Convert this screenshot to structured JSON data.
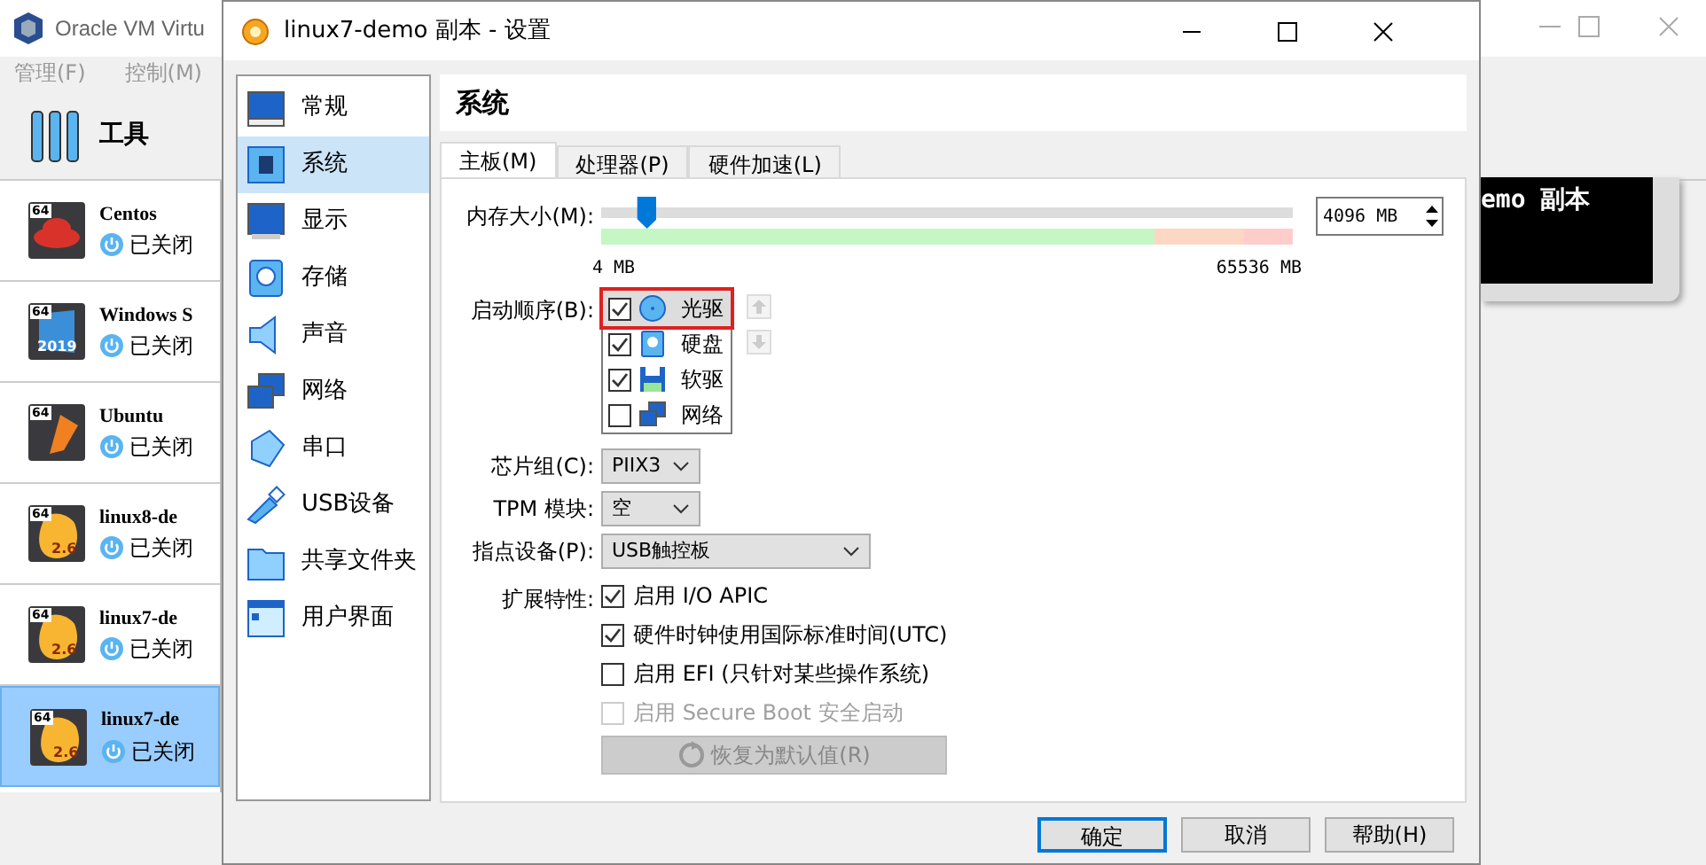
{
  "main_window": {
    "title": "Oracle VM Virtu",
    "menu": [
      "管理(F)",
      "控制(M)"
    ],
    "tools_label": "工具",
    "vms": [
      {
        "name": "Centos",
        "state": "已关闭",
        "badge": "64",
        "selected": false
      },
      {
        "name": "Windows S",
        "state": "已关闭",
        "badge": "64",
        "version": "2019",
        "selected": false
      },
      {
        "name": "Ubuntu",
        "state": "已关闭",
        "badge": "64",
        "selected": false
      },
      {
        "name": "linux8-de",
        "state": "已关闭",
        "badge": "64",
        "version": "2.6",
        "selected": false
      },
      {
        "name": "linux7-de",
        "state": "已关闭",
        "badge": "64",
        "version": "2.6",
        "selected": false
      },
      {
        "name": "linux7-de",
        "state": "已关闭",
        "badge": "64",
        "version": "2.6",
        "selected": true
      }
    ],
    "preview_text": "emo 副本"
  },
  "dialog": {
    "title": "linux7-demo 副本 - 设置",
    "nav": [
      {
        "label": "常规",
        "selected": false
      },
      {
        "label": "系统",
        "selected": true
      },
      {
        "label": "显示",
        "selected": false
      },
      {
        "label": "存储",
        "selected": false
      },
      {
        "label": "声音",
        "selected": false
      },
      {
        "label": "网络",
        "selected": false
      },
      {
        "label": "串口",
        "selected": false
      },
      {
        "label": "USB设备",
        "selected": false
      },
      {
        "label": "共享文件夹",
        "selected": false
      },
      {
        "label": "用户界面",
        "selected": false
      }
    ],
    "section_title": "系统",
    "tabs": [
      {
        "label": "主板(M)",
        "selected": true
      },
      {
        "label": "处理器(P)",
        "selected": false
      },
      {
        "label": "硬件加速(L)",
        "selected": false
      }
    ],
    "memory": {
      "label": "内存大小(M):",
      "level": 0.065,
      "value": "4096 MB",
      "min_label": "4 MB",
      "max_label": "65536 MB"
    },
    "boot_order": {
      "label": "启动顺序(B):",
      "items": [
        {
          "label": "光驱",
          "checked": true,
          "selected": true
        },
        {
          "label": "硬盘",
          "checked": true,
          "selected": false
        },
        {
          "label": "软驱",
          "checked": true,
          "selected": false
        },
        {
          "label": "网络",
          "checked": false,
          "selected": false
        }
      ]
    },
    "selects": [
      {
        "label": "芯片组(C):",
        "value": "PIIX3"
      },
      {
        "label": "TPM 模块:",
        "value": "空"
      },
      {
        "label": "指点设备(P):",
        "value": "USB触控板"
      }
    ],
    "features_label": "扩展特性:",
    "features": [
      {
        "label": "启用 I/O APIC",
        "checked": true,
        "disabled": false
      },
      {
        "label": "硬件时钟使用国际标准时间(UTC)",
        "checked": true,
        "disabled": false
      },
      {
        "label": "启用 EFI (只针对某些操作系统)",
        "checked": false,
        "disabled": false
      },
      {
        "label": "启用 Secure Boot 安全启动",
        "checked": false,
        "disabled": true
      }
    ],
    "reset_button": {
      "label": "恢复为默认值(R)",
      "disabled": true
    },
    "buttons": [
      {
        "label": "确定",
        "default": true
      },
      {
        "label": "取消",
        "default": false
      },
      {
        "label": "帮助(H)",
        "default": false
      }
    ]
  }
}
